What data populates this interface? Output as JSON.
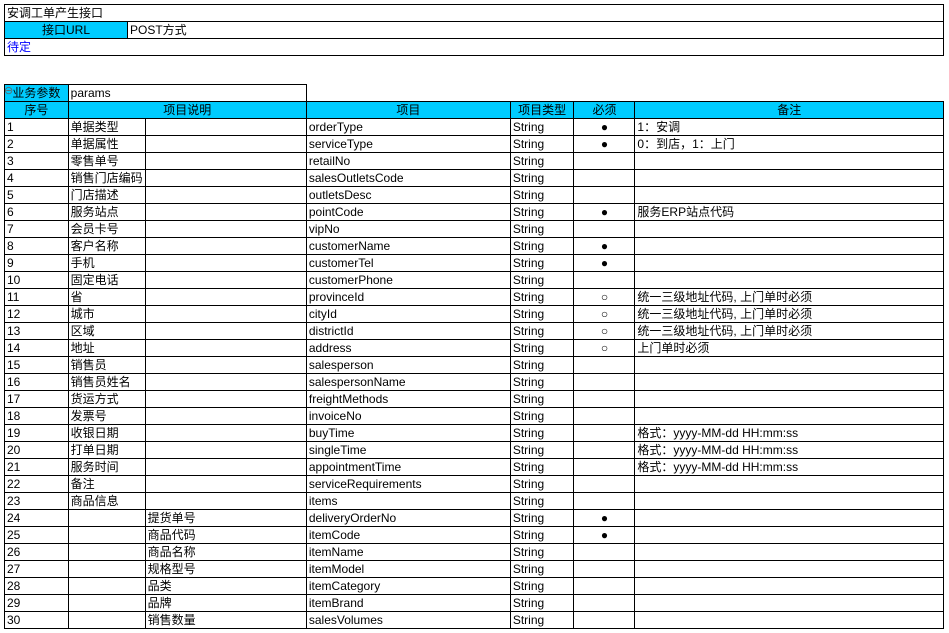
{
  "header": {
    "title": "安调工单产生接口",
    "url_label": "接口URL",
    "url_value": "POST方式",
    "pending": "待定"
  },
  "params": {
    "section_label": "业务参数",
    "section_value": "params",
    "columns": {
      "seq": "序号",
      "desc": "项目说明",
      "item": "项目",
      "type": "项目类型",
      "must": "必须",
      "remark": "备注"
    }
  },
  "marks": {
    "filled": "●",
    "hollow": "○"
  },
  "rows": [
    {
      "seq": "1",
      "desc1": "单据类型",
      "desc2": "",
      "item": "orderType",
      "type": "String",
      "must": "●",
      "remark": "1：安调"
    },
    {
      "seq": "2",
      "desc1": "单据属性",
      "desc2": "",
      "item": "serviceType",
      "type": "String",
      "must": "●",
      "remark": "0：到店，1：上门"
    },
    {
      "seq": "3",
      "desc1": "零售单号",
      "desc2": "",
      "item": "retailNo",
      "type": "String",
      "must": "",
      "remark": ""
    },
    {
      "seq": "4",
      "desc1": "销售门店编码",
      "desc2": "",
      "item": "salesOutletsCode",
      "type": "String",
      "must": "",
      "remark": ""
    },
    {
      "seq": "5",
      "desc1": "门店描述",
      "desc2": "",
      "item": "outletsDesc",
      "type": "String",
      "must": "",
      "remark": ""
    },
    {
      "seq": "6",
      "desc1": "服务站点",
      "desc2": "",
      "item": "pointCode",
      "type": "String",
      "must": "●",
      "remark": "服务ERP站点代码"
    },
    {
      "seq": "7",
      "desc1": "会员卡号",
      "desc2": "",
      "item": "vipNo",
      "type": "String",
      "must": "",
      "remark": ""
    },
    {
      "seq": "8",
      "desc1": "客户名称",
      "desc2": "",
      "item": "customerName",
      "type": "String",
      "must": "●",
      "remark": ""
    },
    {
      "seq": "9",
      "desc1": "手机",
      "desc2": "",
      "item": "customerTel",
      "type": "String",
      "must": "●",
      "remark": ""
    },
    {
      "seq": "10",
      "desc1": "固定电话",
      "desc2": "",
      "item": "customerPhone",
      "type": "String",
      "must": "",
      "remark": ""
    },
    {
      "seq": "11",
      "desc1": "省",
      "desc2": "",
      "item": "provinceId",
      "type": "String",
      "must": "○",
      "remark": "统一三级地址代码, 上门单时必须"
    },
    {
      "seq": "12",
      "desc1": "城市",
      "desc2": "",
      "item": "cityId",
      "type": "String",
      "must": "○",
      "remark": "统一三级地址代码, 上门单时必须"
    },
    {
      "seq": "13",
      "desc1": "区域",
      "desc2": "",
      "item": "districtId",
      "type": "String",
      "must": "○",
      "remark": "统一三级地址代码, 上门单时必须"
    },
    {
      "seq": "14",
      "desc1": "地址",
      "desc2": "",
      "item": "address",
      "type": "String",
      "must": "○",
      "remark": "上门单时必须"
    },
    {
      "seq": "15",
      "desc1": "销售员",
      "desc2": "",
      "item": "salesperson",
      "type": "String",
      "must": "",
      "remark": ""
    },
    {
      "seq": "16",
      "desc1": "销售员姓名",
      "desc2": "",
      "item": "salespersonName",
      "type": "String",
      "must": "",
      "remark": ""
    },
    {
      "seq": "17",
      "desc1": "货运方式",
      "desc2": "",
      "item": "freightMethods",
      "type": "String",
      "must": "",
      "remark": ""
    },
    {
      "seq": "18",
      "desc1": "发票号",
      "desc2": "",
      "item": "invoiceNo",
      "type": "String",
      "must": "",
      "remark": ""
    },
    {
      "seq": "19",
      "desc1": "收银日期",
      "desc2": "",
      "item": "buyTime",
      "type": "String",
      "must": "",
      "remark": "格式：yyyy-MM-dd HH:mm:ss"
    },
    {
      "seq": "20",
      "desc1": "打单日期",
      "desc2": "",
      "item": "singleTime",
      "type": "String",
      "must": "",
      "remark": "格式：yyyy-MM-dd HH:mm:ss"
    },
    {
      "seq": "21",
      "desc1": "服务时间",
      "desc2": "",
      "item": "appointmentTime",
      "type": "String",
      "must": "",
      "remark": "格式：yyyy-MM-dd HH:mm:ss"
    },
    {
      "seq": "22",
      "desc1": "备注",
      "desc2": "",
      "item": "serviceRequirements",
      "type": "String",
      "must": "",
      "remark": ""
    },
    {
      "seq": "23",
      "desc1": "商品信息",
      "desc2": "",
      "item": "items",
      "type": "String",
      "must": "",
      "remark": ""
    },
    {
      "seq": "24",
      "desc1": "",
      "desc2": "提货单号",
      "item": "deliveryOrderNo",
      "type": "String",
      "must": "●",
      "remark": ""
    },
    {
      "seq": "25",
      "desc1": "",
      "desc2": "商品代码",
      "item": "itemCode",
      "type": "String",
      "must": "●",
      "remark": ""
    },
    {
      "seq": "26",
      "desc1": "",
      "desc2": "商品名称",
      "item": "itemName",
      "type": "String",
      "must": "",
      "remark": ""
    },
    {
      "seq": "27",
      "desc1": "",
      "desc2": "规格型号",
      "item": "itemModel",
      "type": "String",
      "must": "",
      "remark": ""
    },
    {
      "seq": "28",
      "desc1": "",
      "desc2": "品类",
      "item": "itemCategory",
      "type": "String",
      "must": "",
      "remark": ""
    },
    {
      "seq": "29",
      "desc1": "",
      "desc2": "品牌",
      "item": "itemBrand",
      "type": "String",
      "must": "",
      "remark": ""
    },
    {
      "seq": "30",
      "desc1": "",
      "desc2": "销售数量",
      "item": "salesVolumes",
      "type": "String",
      "must": "",
      "remark": ""
    }
  ]
}
